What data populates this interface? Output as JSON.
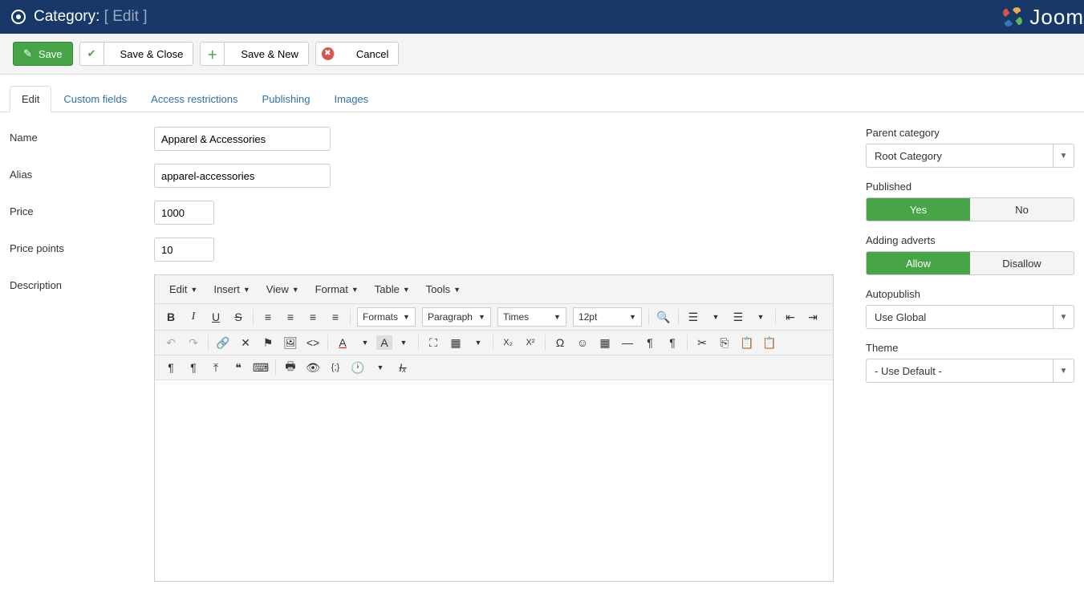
{
  "header": {
    "title_prefix": "Category:",
    "title_suffix": "[ Edit ]",
    "brand": "Joom"
  },
  "toolbar": {
    "save": "Save",
    "save_close": "Save & Close",
    "save_new": "Save & New",
    "cancel": "Cancel"
  },
  "tabs": [
    "Edit",
    "Custom fields",
    "Access restrictions",
    "Publishing",
    "Images"
  ],
  "fields": {
    "name_label": "Name",
    "name_value": "Apparel & Accessories",
    "alias_label": "Alias",
    "alias_value": "apparel-accessories",
    "price_label": "Price",
    "price_value": "1000",
    "points_label": "Price points",
    "points_value": "10",
    "desc_label": "Description"
  },
  "editor": {
    "menus": [
      "Edit",
      "Insert",
      "View",
      "Format",
      "Table",
      "Tools"
    ],
    "formats": "Formats",
    "para": "Paragraph",
    "font": "Times",
    "size": "12pt"
  },
  "side": {
    "parent_label": "Parent category",
    "parent_value": "Root Category",
    "pub_label": "Published",
    "pub_yes": "Yes",
    "pub_no": "No",
    "adv_label": "Adding adverts",
    "adv_allow": "Allow",
    "adv_disallow": "Disallow",
    "auto_label": "Autopublish",
    "auto_value": "Use Global",
    "theme_label": "Theme",
    "theme_value": "- Use Default -"
  }
}
